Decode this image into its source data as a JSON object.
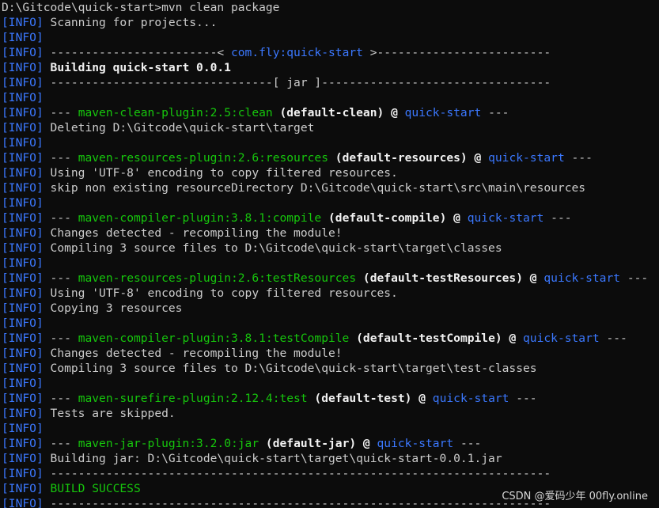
{
  "prompt": "D:\\Gitcode\\quick-start>mvn clean package",
  "tag": "INFO",
  "lines": [
    [
      {
        "t": "Scanning for projects...",
        "c": "plain"
      }
    ],
    [],
    [
      {
        "t": "------------------------< ",
        "c": "plain"
      },
      {
        "t": "com.fly:quick-start",
        "c": "artifact"
      },
      {
        "t": " >-------------------------",
        "c": "plain"
      }
    ],
    [
      {
        "t": "Building quick-start 0.0.1",
        "c": "bold"
      }
    ],
    [
      {
        "t": "--------------------------------[ jar ]---------------------------------",
        "c": "plain"
      }
    ],
    [],
    [
      {
        "t": "--- ",
        "c": "plain"
      },
      {
        "t": "maven-clean-plugin:2.5:clean",
        "c": "plugin"
      },
      {
        "t": " (default-clean) @ ",
        "c": "bold"
      },
      {
        "t": "quick-start",
        "c": "artifact"
      },
      {
        "t": " ---",
        "c": "plain"
      }
    ],
    [
      {
        "t": "Deleting D:\\Gitcode\\quick-start\\target",
        "c": "plain"
      }
    ],
    [],
    [
      {
        "t": "--- ",
        "c": "plain"
      },
      {
        "t": "maven-resources-plugin:2.6:resources",
        "c": "plugin"
      },
      {
        "t": " (default-resources) @ ",
        "c": "bold"
      },
      {
        "t": "quick-start",
        "c": "artifact"
      },
      {
        "t": " ---",
        "c": "plain"
      }
    ],
    [
      {
        "t": "Using 'UTF-8' encoding to copy filtered resources.",
        "c": "plain"
      }
    ],
    [
      {
        "t": "skip non existing resourceDirectory D:\\Gitcode\\quick-start\\src\\main\\resources",
        "c": "plain"
      }
    ],
    [],
    [
      {
        "t": "--- ",
        "c": "plain"
      },
      {
        "t": "maven-compiler-plugin:3.8.1:compile",
        "c": "plugin"
      },
      {
        "t": " (default-compile) @ ",
        "c": "bold"
      },
      {
        "t": "quick-start",
        "c": "artifact"
      },
      {
        "t": " ---",
        "c": "plain"
      }
    ],
    [
      {
        "t": "Changes detected - recompiling the module!",
        "c": "plain"
      }
    ],
    [
      {
        "t": "Compiling 3 source files to D:\\Gitcode\\quick-start\\target\\classes",
        "c": "plain"
      }
    ],
    [],
    [
      {
        "t": "--- ",
        "c": "plain"
      },
      {
        "t": "maven-resources-plugin:2.6:testResources",
        "c": "plugin"
      },
      {
        "t": " (default-testResources) @ ",
        "c": "bold"
      },
      {
        "t": "quick-start",
        "c": "artifact"
      },
      {
        "t": " ---",
        "c": "plain"
      }
    ],
    [
      {
        "t": "Using 'UTF-8' encoding to copy filtered resources.",
        "c": "plain"
      }
    ],
    [
      {
        "t": "Copying 3 resources",
        "c": "plain"
      }
    ],
    [],
    [
      {
        "t": "--- ",
        "c": "plain"
      },
      {
        "t": "maven-compiler-plugin:3.8.1:testCompile",
        "c": "plugin"
      },
      {
        "t": " (default-testCompile) @ ",
        "c": "bold"
      },
      {
        "t": "quick-start",
        "c": "artifact"
      },
      {
        "t": " ---",
        "c": "plain"
      }
    ],
    [
      {
        "t": "Changes detected - recompiling the module!",
        "c": "plain"
      }
    ],
    [
      {
        "t": "Compiling 3 source files to D:\\Gitcode\\quick-start\\target\\test-classes",
        "c": "plain"
      }
    ],
    [],
    [
      {
        "t": "--- ",
        "c": "plain"
      },
      {
        "t": "maven-surefire-plugin:2.12.4:test",
        "c": "plugin"
      },
      {
        "t": " (default-test) @ ",
        "c": "bold"
      },
      {
        "t": "quick-start",
        "c": "artifact"
      },
      {
        "t": " ---",
        "c": "plain"
      }
    ],
    [
      {
        "t": "Tests are skipped.",
        "c": "plain"
      }
    ],
    [],
    [
      {
        "t": "--- ",
        "c": "plain"
      },
      {
        "t": "maven-jar-plugin:3.2.0:jar",
        "c": "plugin"
      },
      {
        "t": " (default-jar) @ ",
        "c": "bold"
      },
      {
        "t": "quick-start",
        "c": "artifact"
      },
      {
        "t": " ---",
        "c": "plain"
      }
    ],
    [
      {
        "t": "Building jar: D:\\Gitcode\\quick-start\\target\\quick-start-0.0.1.jar",
        "c": "plain"
      }
    ],
    [
      {
        "t": "------------------------------------------------------------------------",
        "c": "plain"
      }
    ],
    [
      {
        "t": "BUILD SUCCESS",
        "c": "success"
      }
    ],
    [
      {
        "t": "------------------------------------------------------------------------",
        "c": "plain"
      }
    ]
  ],
  "watermark": "CSDN @爱码少年 00fly.online",
  "colors": {
    "background": "#0c0c0c",
    "text": "#cccccc",
    "info_tag": "#3b78ff",
    "plugin": "#16c60c",
    "artifact": "#3b78ff",
    "bold": "#f2f2f2",
    "success": "#16c60c"
  }
}
